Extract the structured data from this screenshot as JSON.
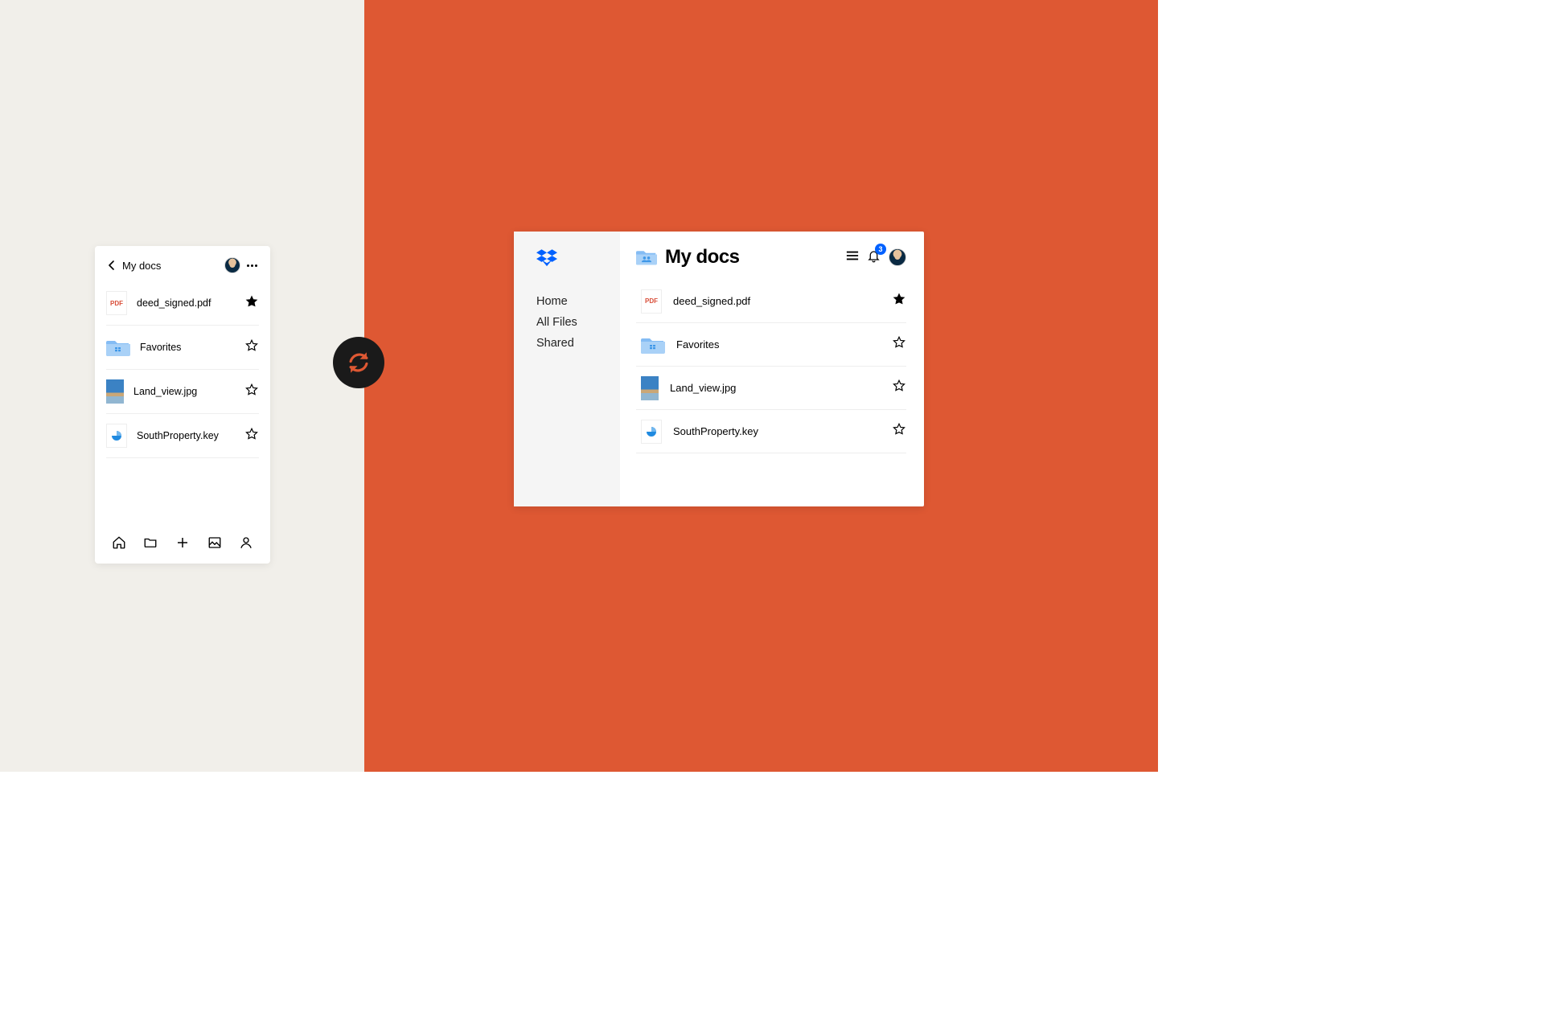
{
  "folder_title": "My docs",
  "notification_count": "3",
  "files": [
    {
      "name": "deed_signed.pdf",
      "type": "pdf",
      "pdf_label": "PDF",
      "starred": true
    },
    {
      "name": "Favorites",
      "type": "folder",
      "starred": false
    },
    {
      "name": "Land_view.jpg",
      "type": "photo",
      "starred": false
    },
    {
      "name": "SouthProperty.key",
      "type": "key",
      "starred": false
    }
  ],
  "desktop_nav": {
    "home": "Home",
    "allfiles": "All Files",
    "shared": "Shared"
  }
}
